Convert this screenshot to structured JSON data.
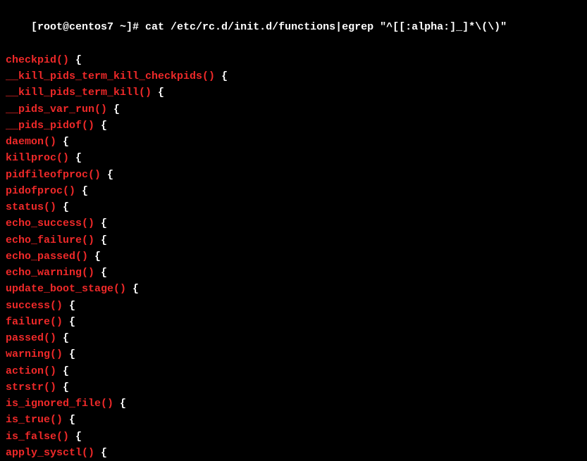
{
  "prompt": "[root@centos7 ~]# cat /etc/rc.d/init.d/functions|egrep \"^[[:alpha:]_]*\\(\\)\"",
  "lines": [
    {
      "match": "checkpid()",
      "rest": " {"
    },
    {
      "match": "__kill_pids_term_kill_checkpids()",
      "rest": " {"
    },
    {
      "match": "__kill_pids_term_kill()",
      "rest": " {"
    },
    {
      "match": "__pids_var_run()",
      "rest": " {"
    },
    {
      "match": "__pids_pidof()",
      "rest": " {"
    },
    {
      "match": "daemon()",
      "rest": " {"
    },
    {
      "match": "killproc()",
      "rest": " {"
    },
    {
      "match": "pidfileofproc()",
      "rest": " {"
    },
    {
      "match": "pidofproc()",
      "rest": " {"
    },
    {
      "match": "status()",
      "rest": " {"
    },
    {
      "match": "echo_success()",
      "rest": " {"
    },
    {
      "match": "echo_failure()",
      "rest": " {"
    },
    {
      "match": "echo_passed()",
      "rest": " {"
    },
    {
      "match": "echo_warning()",
      "rest": " {"
    },
    {
      "match": "update_boot_stage()",
      "rest": " {"
    },
    {
      "match": "success()",
      "rest": " {"
    },
    {
      "match": "failure()",
      "rest": " {"
    },
    {
      "match": "passed()",
      "rest": " {"
    },
    {
      "match": "warning()",
      "rest": " {"
    },
    {
      "match": "action()",
      "rest": " {"
    },
    {
      "match": "strstr()",
      "rest": " {"
    },
    {
      "match": "is_ignored_file()",
      "rest": " {"
    },
    {
      "match": "is_true()",
      "rest": " {"
    },
    {
      "match": "is_false()",
      "rest": " {"
    },
    {
      "match": "apply_sysctl()",
      "rest": " {"
    }
  ]
}
